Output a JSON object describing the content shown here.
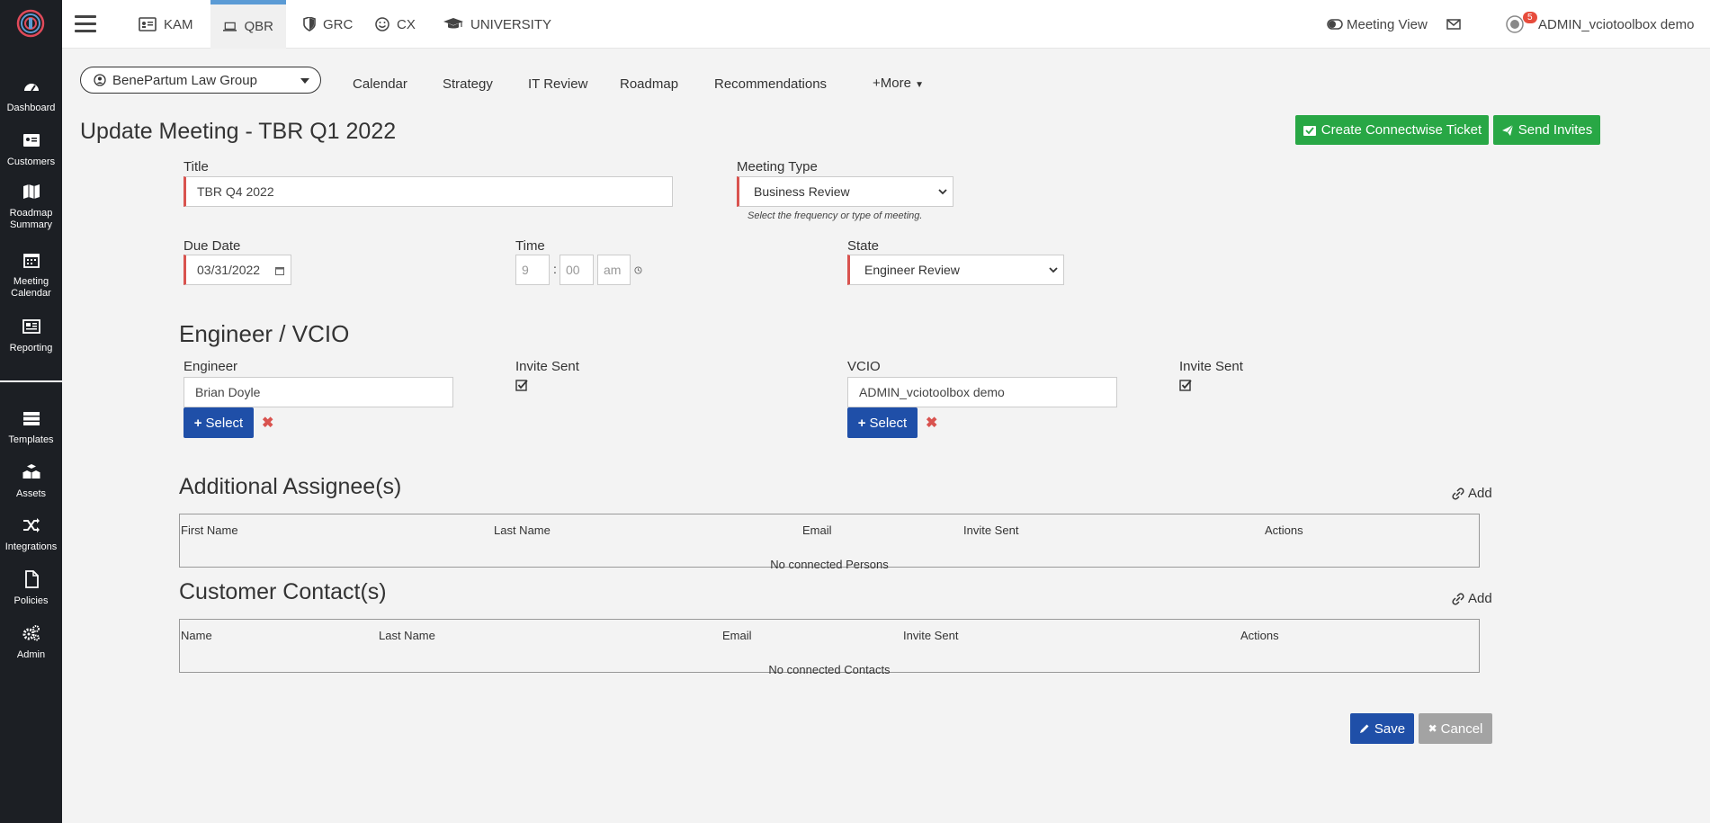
{
  "sidebar": {
    "items": [
      {
        "label": "Dashboard",
        "icon": "dashboard-icon"
      },
      {
        "label": "Customers",
        "icon": "customers-card-icon"
      },
      {
        "label": "Roadmap Summary",
        "icon": "map-icon"
      },
      {
        "label": "Meeting Calendar",
        "icon": "calendar-icon"
      },
      {
        "label": "Reporting",
        "icon": "reporting-icon"
      },
      {
        "label": "Templates",
        "icon": "templates-icon"
      },
      {
        "label": "Assets",
        "icon": "assets-cubes-icon"
      },
      {
        "label": "Integrations",
        "icon": "shuffle-icon"
      },
      {
        "label": "Policies",
        "icon": "document-icon"
      },
      {
        "label": "Admin",
        "icon": "gears-icon"
      }
    ]
  },
  "topbar": {
    "tabs": [
      {
        "label": "KAM"
      },
      {
        "label": "QBR"
      },
      {
        "label": "GRC"
      },
      {
        "label": "CX"
      },
      {
        "label": "UNIVERSITY"
      }
    ],
    "meeting_view": "Meeting View",
    "mail_count": "5",
    "user": "ADMIN_vciotoolbox demo"
  },
  "subnav": {
    "customer": "BenePartum Law Group",
    "links": [
      "Calendar",
      "Strategy",
      "IT Review",
      "Roadmap",
      "Recommendations"
    ],
    "more": "+More"
  },
  "page": {
    "title": "Update Meeting - TBR Q1 2022",
    "create_ticket": "Create Connectwise Ticket",
    "send_invites": "Send Invites"
  },
  "form": {
    "title_label": "Title",
    "title_value": "TBR Q4 2022",
    "meeting_type_label": "Meeting Type",
    "meeting_type_value": "Business Review",
    "meeting_type_hint": "Select the frequency or type of meeting.",
    "due_date_label": "Due Date",
    "due_date_value": "03/31/2022",
    "time_label": "Time",
    "time_hour": "9",
    "time_sep": ":",
    "time_min": "00",
    "time_ampm": "am",
    "state_label": "State",
    "state_value": "Engineer Review"
  },
  "engineer_section": {
    "title": "Engineer / VCIO",
    "engineer_label": "Engineer",
    "engineer_value": "Brian Doyle",
    "invite_sent_label": "Invite Sent",
    "vcio_label": "VCIO",
    "vcio_value": "ADMIN_vciotoolbox demo",
    "invite_sent_label_2": "Invite Sent",
    "select_label": "Select"
  },
  "assignees": {
    "title": "Additional Assignee(s)",
    "add": "Add",
    "columns": [
      "First Name",
      "Last Name",
      "Email",
      "Invite Sent",
      "Actions"
    ],
    "empty": "No connected Persons"
  },
  "contacts": {
    "title": "Customer Contact(s)",
    "add": "Add",
    "columns": [
      "Name",
      "Last Name",
      "Email",
      "Invite Sent",
      "Actions"
    ],
    "empty": "No connected Contacts"
  },
  "footer": {
    "save": "Save",
    "cancel": "Cancel"
  },
  "colors": {
    "sidebar_bg": "#1c1f24",
    "green": "#28a745",
    "blue": "#1f4fa8",
    "required_border": "#d9534f",
    "badge": "#e74c3c"
  }
}
